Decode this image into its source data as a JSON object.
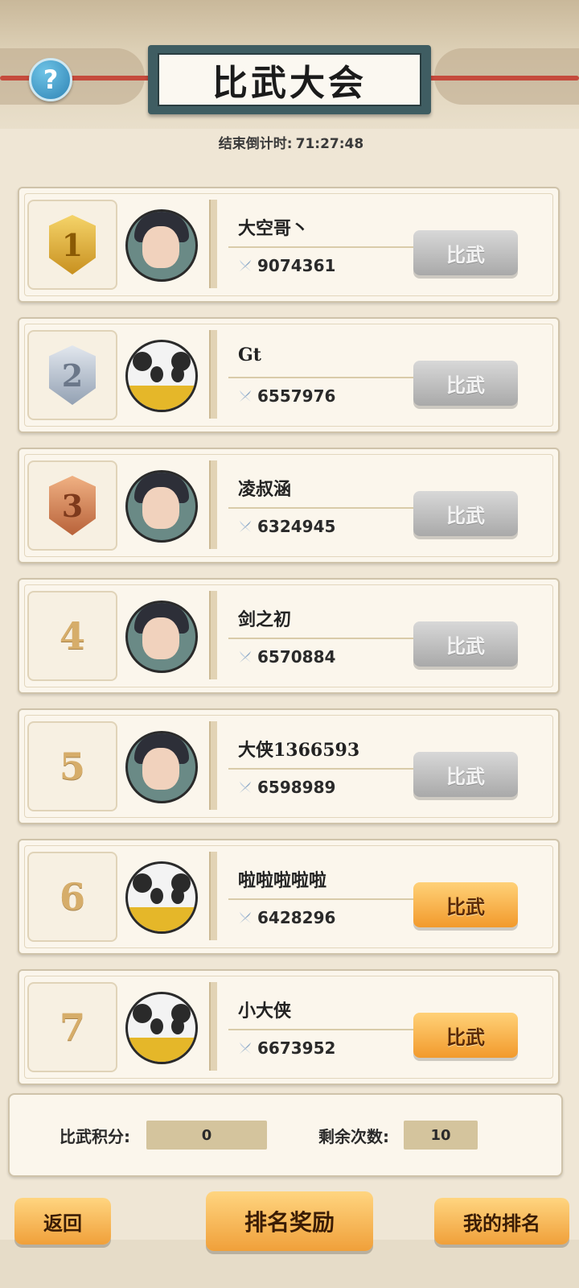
{
  "header": {
    "title": "比武大会",
    "help_icon": "?",
    "countdown_label": "结束倒计时:",
    "countdown_value": "71:27:48"
  },
  "players": [
    {
      "rank": "1",
      "badge": "gold",
      "avatar": "swordsman",
      "name": "大空哥丶",
      "power": "9074361",
      "button": "比武",
      "enabled": false
    },
    {
      "rank": "2",
      "badge": "silver",
      "avatar": "panda",
      "name": "Gt",
      "power": "6557976",
      "button": "比武",
      "enabled": false
    },
    {
      "rank": "3",
      "badge": "bronze",
      "avatar": "lady",
      "name": "凌叔涵",
      "power": "6324945",
      "button": "比武",
      "enabled": false
    },
    {
      "rank": "4",
      "badge": "",
      "avatar": "scholar",
      "name": "剑之初",
      "power": "6570884",
      "button": "比武",
      "enabled": false
    },
    {
      "rank": "5",
      "badge": "",
      "avatar": "warrior",
      "name": "大侠1366593",
      "power": "6598989",
      "button": "比武",
      "enabled": false
    },
    {
      "rank": "6",
      "badge": "",
      "avatar": "panda",
      "name": "啦啦啦啦啦",
      "power": "6428296",
      "button": "比武",
      "enabled": true
    },
    {
      "rank": "7",
      "badge": "",
      "avatar": "panda",
      "name": "小大侠",
      "power": "6673952",
      "button": "比武",
      "enabled": true
    }
  ],
  "stats": {
    "score_label": "比武积分:",
    "score_value": "0",
    "remaining_label": "剩余次数:",
    "remaining_value": "10"
  },
  "footer": {
    "back": "返回",
    "rank_rewards": "排名奖励",
    "my_rank": "我的排名"
  },
  "colors": {
    "button_enabled": "#f29a2c",
    "button_disabled": "#a9a9a9",
    "rope": "#c54a3c",
    "title_board": "#3f5d62"
  }
}
